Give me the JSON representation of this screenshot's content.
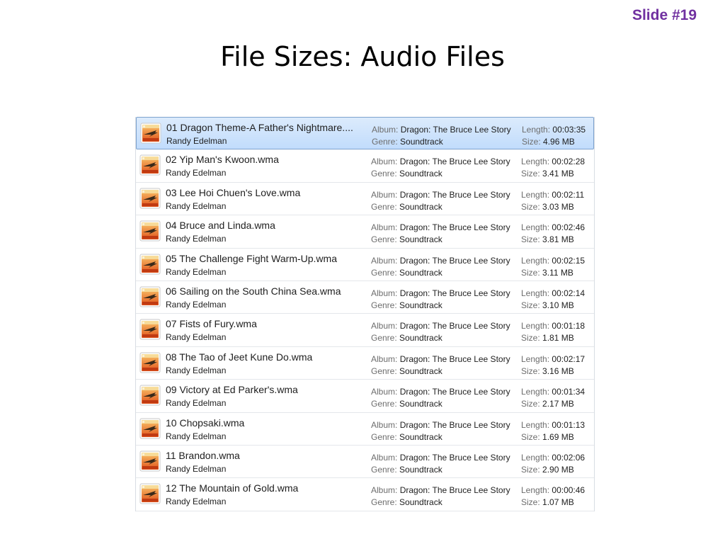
{
  "slide_number": "Slide #19",
  "title": "File Sizes: Audio Files",
  "labels": {
    "album": "Album:",
    "genre": "Genre:",
    "length": "Length:",
    "size": "Size:"
  },
  "files": [
    {
      "name": "01 Dragon Theme-A Father's Nightmare....",
      "artist": "Randy Edelman",
      "album": "Dragon: The Bruce Lee Story",
      "genre": "Soundtrack",
      "length": "00:03:35",
      "size": "4.96 MB",
      "selected": true
    },
    {
      "name": "02 Yip Man's Kwoon.wma",
      "artist": "Randy Edelman",
      "album": "Dragon: The Bruce Lee Story",
      "genre": "Soundtrack",
      "length": "00:02:28",
      "size": "3.41 MB"
    },
    {
      "name": "03 Lee Hoi Chuen's Love.wma",
      "artist": "Randy Edelman",
      "album": "Dragon: The Bruce Lee Story",
      "genre": "Soundtrack",
      "length": "00:02:11",
      "size": "3.03 MB"
    },
    {
      "name": "04 Bruce and Linda.wma",
      "artist": "Randy Edelman",
      "album": "Dragon: The Bruce Lee Story",
      "genre": "Soundtrack",
      "length": "00:02:46",
      "size": "3.81 MB"
    },
    {
      "name": "05 The Challenge Fight Warm-Up.wma",
      "artist": "Randy Edelman",
      "album": "Dragon: The Bruce Lee Story",
      "genre": "Soundtrack",
      "length": "00:02:15",
      "size": "3.11 MB"
    },
    {
      "name": "06 Sailing on the South China Sea.wma",
      "artist": "Randy Edelman",
      "album": "Dragon: The Bruce Lee Story",
      "genre": "Soundtrack",
      "length": "00:02:14",
      "size": "3.10 MB"
    },
    {
      "name": "07 Fists of Fury.wma",
      "artist": "Randy Edelman",
      "album": "Dragon: The Bruce Lee Story",
      "genre": "Soundtrack",
      "length": "00:01:18",
      "size": "1.81 MB"
    },
    {
      "name": "08 The Tao of Jeet Kune Do.wma",
      "artist": "Randy Edelman",
      "album": "Dragon: The Bruce Lee Story",
      "genre": "Soundtrack",
      "length": "00:02:17",
      "size": "3.16 MB"
    },
    {
      "name": "09 Victory at Ed Parker's.wma",
      "artist": "Randy Edelman",
      "album": "Dragon: The Bruce Lee Story",
      "genre": "Soundtrack",
      "length": "00:01:34",
      "size": "2.17 MB"
    },
    {
      "name": "10 Chopsaki.wma",
      "artist": "Randy Edelman",
      "album": "Dragon: The Bruce Lee Story",
      "genre": "Soundtrack",
      "length": "00:01:13",
      "size": "1.69 MB"
    },
    {
      "name": "11 Brandon.wma",
      "artist": "Randy Edelman",
      "album": "Dragon: The Bruce Lee Story",
      "genre": "Soundtrack",
      "length": "00:02:06",
      "size": "2.90 MB"
    },
    {
      "name": "12 The Mountain of Gold.wma",
      "artist": "Randy Edelman",
      "album": "Dragon: The Bruce Lee Story",
      "genre": "Soundtrack",
      "length": "00:00:46",
      "size": "1.07 MB"
    }
  ],
  "icon_name": "media-file-icon",
  "colors": {
    "slide_number": "#7030a0",
    "selection": "#c1dcfc"
  }
}
